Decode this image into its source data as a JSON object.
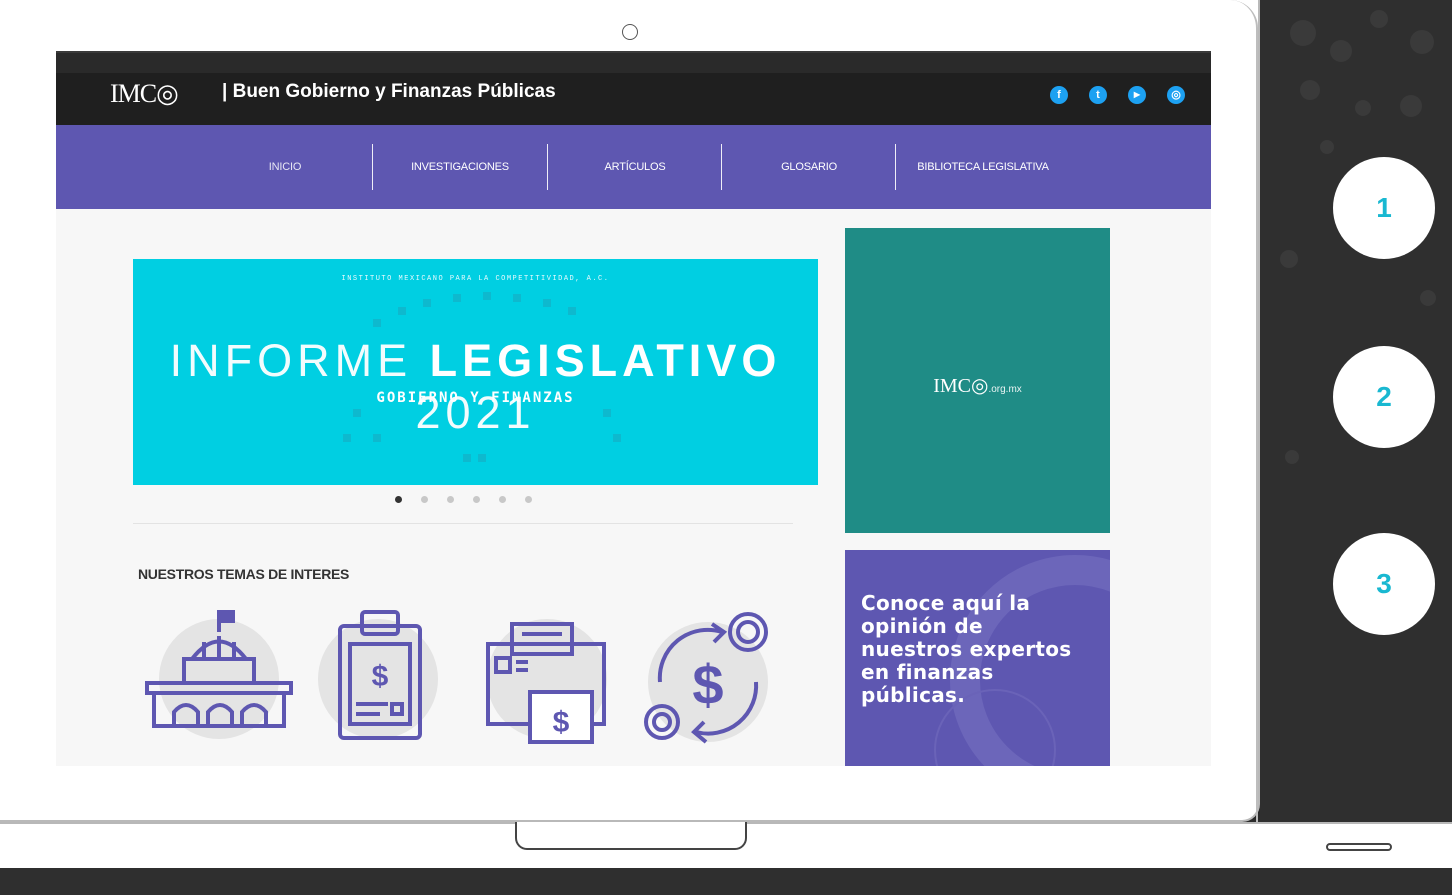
{
  "site": {
    "logo": "IMC◎",
    "title": "| Buen Gobierno y Finanzas Públicas",
    "social": [
      {
        "icon": "facebook-icon",
        "glyph": "f"
      },
      {
        "icon": "twitter-icon",
        "glyph": "t"
      },
      {
        "icon": "youtube-icon",
        "glyph": "▶"
      },
      {
        "icon": "instagram-icon",
        "glyph": "◎"
      }
    ]
  },
  "nav": {
    "items": [
      "INICIO",
      "INVESTIGACIONES",
      "ARTÍCULOS",
      "GLOSARIO",
      "BIBLIOTECA LEGISLATIVA"
    ]
  },
  "hero": {
    "mini": "INSTITUTO MEXICANO PARA LA COMPETITIVIDAD, A.C.",
    "title_light": "INFORME ",
    "title_bold": "LEGISLATIVO",
    "title_year": " 2021",
    "subtitle": "GOBIERNO Y FINANZAS",
    "pager_count": 6,
    "pager_active": 0
  },
  "topics": {
    "title": "NUESTROS TEMAS DE INTERES"
  },
  "sidebar": {
    "ad1_logo": "IMC◎",
    "ad1_domain": ".org.mx",
    "ad2_text": "Conoce aquí la opinión de nuestros expertos en finanzas públicas."
  },
  "badges": [
    "1",
    "2",
    "3"
  ],
  "colors": {
    "accent": "#5e57b1",
    "hero": "#00cfe2",
    "ad": "#1f8c86",
    "badge_text": "#19b8d1"
  }
}
